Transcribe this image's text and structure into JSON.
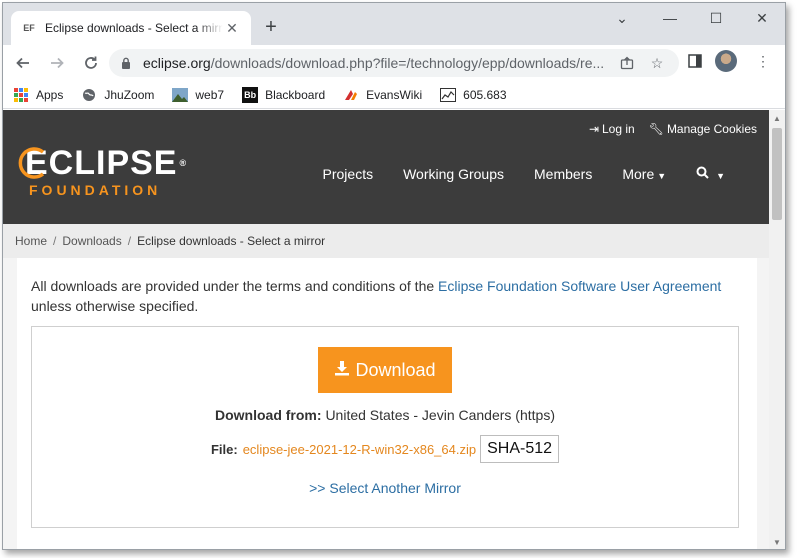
{
  "browser": {
    "tab": {
      "favicon": "EF",
      "title": "Eclipse downloads - Select a mirror"
    },
    "url": {
      "host": "eclipse.org",
      "path": "/downloads/download.php?file=/technology/epp/downloads/re..."
    },
    "bookmarks": [
      {
        "label": "Apps",
        "icon": "apps-grid-icon"
      },
      {
        "label": "JhuZoom",
        "icon": "globe-icon"
      },
      {
        "label": "web7",
        "icon": "image-icon"
      },
      {
        "label": "Blackboard",
        "icon": "bb-icon"
      },
      {
        "label": "EvansWiki",
        "icon": "wiki-icon"
      },
      {
        "label": "605.683",
        "icon": "chart-icon"
      }
    ]
  },
  "site": {
    "header_links": {
      "login": "Log in",
      "cookies": "Manage Cookies"
    },
    "logo": {
      "main": "ECLIPSE",
      "sub": "FOUNDATION"
    },
    "nav": [
      "Projects",
      "Working Groups",
      "Members",
      "More"
    ],
    "breadcrumb": [
      "Home",
      "Downloads",
      "Eclipse downloads - Select a mirror"
    ],
    "terms": {
      "prefix": "All downloads are provided under the terms and conditions of the ",
      "link": "Eclipse Foundation Software User Agreement",
      "suffix": "unless otherwise specified."
    },
    "download": {
      "button": "Download",
      "from_label": "Download from:",
      "from_value": "United States - Jevin Canders (https)",
      "file_label": "File:",
      "file_name": "eclipse-jee-2021-12-R-win32-x86_64.zip",
      "sha": "SHA-512",
      "alt_mirror": ">> Select Another Mirror"
    },
    "colors": {
      "accent": "#f7941e",
      "header_bg": "#3c3c3c",
      "link": "#2c6ea3"
    }
  }
}
